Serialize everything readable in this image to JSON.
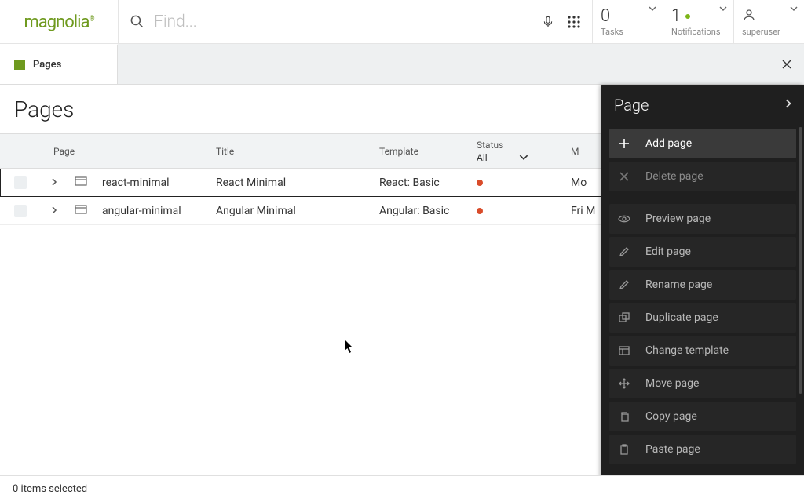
{
  "header": {
    "logo_text": "magnolia",
    "search_placeholder": "Find...",
    "tasks": {
      "count": "0",
      "label": "Tasks"
    },
    "notifications": {
      "count": "1",
      "label": "Notifications"
    },
    "user": {
      "name": "superuser"
    }
  },
  "tabs": {
    "active": {
      "label": "Pages"
    }
  },
  "page": {
    "title": "Pages"
  },
  "table": {
    "headers": {
      "page": "Page",
      "title": "Title",
      "template": "Template",
      "status": "Status",
      "status_filter": "All",
      "modified": "M"
    },
    "rows": [
      {
        "page": "react-minimal",
        "title": "React Minimal",
        "template": "React: Basic",
        "status": "modified",
        "modified": "Mo"
      },
      {
        "page": "angular-minimal",
        "title": "Angular Minimal",
        "template": "Angular: Basic",
        "status": "modified",
        "modified": "Fri M"
      }
    ]
  },
  "panel": {
    "title": "Page",
    "actions": {
      "add": "Add page",
      "delete": "Delete page",
      "preview": "Preview page",
      "edit": "Edit page",
      "rename": "Rename page",
      "duplicate": "Duplicate page",
      "change_template": "Change template",
      "move": "Move page",
      "copy": "Copy page",
      "paste": "Paste page"
    }
  },
  "footer": {
    "selection": "0 items selected"
  }
}
